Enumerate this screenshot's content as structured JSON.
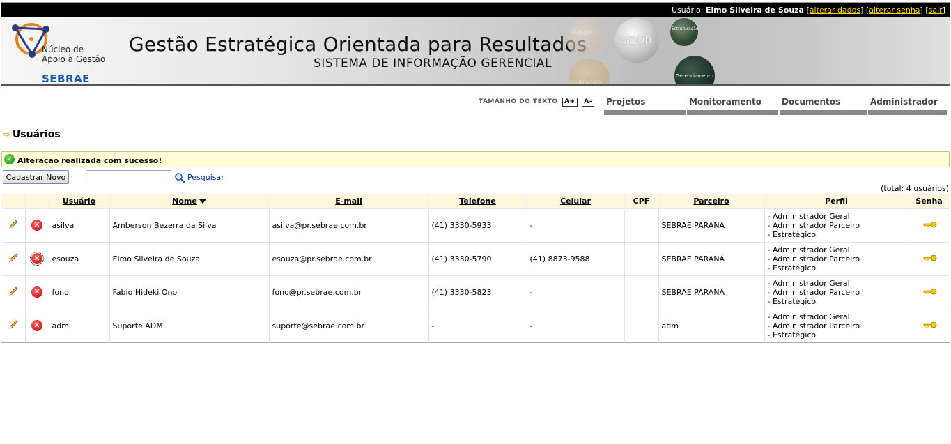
{
  "topbar": {
    "user_prefix": "Usuário: ",
    "user_name": "Elmo Silveira de Souza",
    "link_alterar_dados": "alterar dados",
    "link_alterar_senha": "alterar senha",
    "link_sair": "sair"
  },
  "header": {
    "logo_line1": "Núcleo de",
    "logo_line2": "Apoio à Gestão",
    "logo_brand": "SEBRAE",
    "title": "Gestão Estratégica Orientada para Resultados",
    "subtitle": "SISTEMA DE INFORMAÇÃO GERENCIAL",
    "sphere_geor": "GEOR",
    "sphere_estruturacao": "Estruturação",
    "sphere_gerenciamento": "Gerenciamento",
    "sphere_faded1": "Avaliação",
    "sphere_faded2": "Monitoramento"
  },
  "text_size": {
    "label": "TAMANHO DO TEXTO",
    "increase": "A+",
    "decrease": "A-"
  },
  "nav": {
    "items": [
      {
        "label": "Projetos"
      },
      {
        "label": "Monitoramento"
      },
      {
        "label": "Documentos"
      },
      {
        "label": "Administrador"
      }
    ]
  },
  "page": {
    "title": "Usuários",
    "success_message": "Alteração realizada com sucesso!",
    "new_button": "Cadastrar Novo",
    "search_value": "",
    "search_link": "Pesquisar",
    "total": "(total: 4 usuários)"
  },
  "table": {
    "columns": [
      "Usuário",
      "Nome",
      "E-mail",
      "Telefone",
      "Celular",
      "CPF",
      "Parceiro",
      "Perfil",
      "Senha"
    ],
    "rows": [
      {
        "usuario": "asilva",
        "nome": "Amberson Bezerra da Silva",
        "email": "asilva@pr.sebrae.com.br",
        "telefone": "(41) 3330-5933",
        "celular": "-",
        "cpf": "",
        "parceiro": "SEBRAE PARANÁ",
        "perfil": [
          "- Administrador Geral",
          "- Administrador Parceiro",
          "- Estratégico"
        ]
      },
      {
        "usuario": "esouza",
        "nome": "Elmo Silveira de Souza",
        "email": "esouza@pr.sebrae.com.br",
        "telefone": "(41) 3330-5790",
        "celular": "(41) 8873-9588",
        "cpf": "",
        "parceiro": "SEBRAE PARANÁ",
        "perfil": [
          "- Administrador Geral",
          "- Administrador Parceiro",
          "- Estratégico"
        ]
      },
      {
        "usuario": "fono",
        "nome": "Fabio Hideki Ono",
        "email": "fono@pr.sebrae.com.br",
        "telefone": "(41) 3330-5823",
        "celular": "-",
        "cpf": "",
        "parceiro": "SEBRAE PARANÁ",
        "perfil": [
          "- Administrador Geral",
          "- Administrador Parceiro",
          "- Estratégico"
        ]
      },
      {
        "usuario": "adm",
        "nome": "Suporte ADM",
        "email": "suporte@sebrae.com.br",
        "telefone": "-",
        "celular": "-",
        "cpf": "",
        "parceiro": "adm",
        "perfil": [
          "- Administrador Geral",
          "- Administrador Parceiro",
          "- Estratégico"
        ]
      }
    ]
  },
  "icons": {
    "edit": "pencil-icon",
    "delete": "delete-icon",
    "password": "key-icon",
    "success": "check-icon",
    "search": "search-icon"
  }
}
